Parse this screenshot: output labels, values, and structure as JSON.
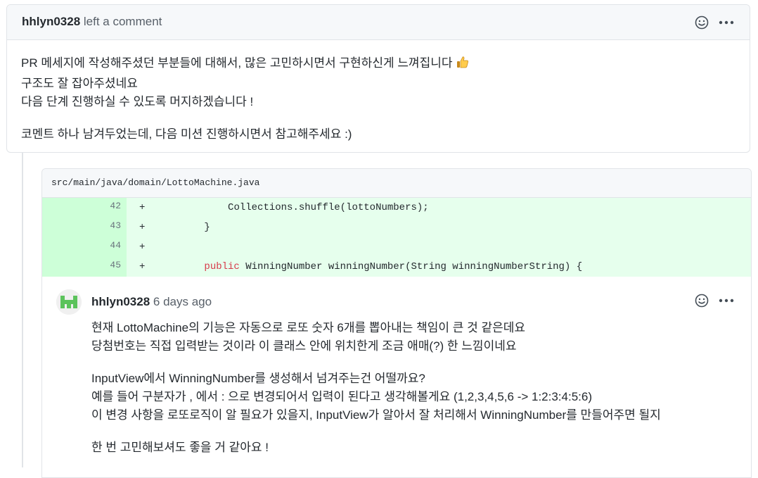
{
  "comment": {
    "author": "hhlyn0328",
    "action": "left a comment",
    "paragraphs": [
      [
        "PR 메세지에 작성해주셨던 부분들에 대해서, 많은 고민하시면서 구현하신게 느껴집니다",
        "구조도 잘 잡아주셨네요",
        "다음 단계 진행하실 수 있도록 머지하겠습니다 !"
      ],
      [
        "코멘트 하나 남겨두었는데, 다음 미션 진행하시면서 참고해주세요 :)"
      ]
    ],
    "emoji_icon": "thumbs-up-icon"
  },
  "review": {
    "file_path": "src/main/java/domain/LottoMachine.java",
    "diff_lines": [
      {
        "num": "42",
        "sign": "+",
        "code": "        Collections.shuffle(lottoNumbers);"
      },
      {
        "num": "43",
        "sign": "+",
        "code": "    }"
      },
      {
        "num": "44",
        "sign": "+",
        "code": ""
      },
      {
        "num": "45",
        "sign": "+",
        "keyword": "public",
        "code": " WinningNumber winningNumber(String winningNumberString) {"
      }
    ],
    "reply": {
      "author": "hhlyn0328",
      "time": "6 days ago",
      "lines": [
        "현재 LottoMachine의 기능은 자동으로 로또 숫자 6개를 뽑아내는 책임이 큰 것 같은데요",
        "당첨번호는 직접 입력받는 것이라 이 클래스 안에 위치한게 조금 애매(?) 한 느낌이네요",
        "",
        "InputView에서 WinningNumber를 생성해서 넘겨주는건 어떨까요?",
        "예를 들어 구분자가 , 에서 : 으로 변경되어서 입력이 된다고 생각해볼게요 (1,2,3,4,5,6 -> 1:2:3:4:5:6)",
        "이 변경 사항을 로또로직이 알 필요가 있을지, InputView가 알아서 잘 처리해서 WinningNumber를 만들어주면 될지",
        "",
        "한 번 고민해보셔도 좋을 거 같아요 !"
      ]
    }
  },
  "icons": {
    "reaction": "smiley-icon",
    "more": "kebab-horizontal-icon",
    "avatar": "identicon-avatar"
  },
  "colors": {
    "diff_add_bg": "#e6ffed",
    "diff_add_num_bg": "#cdffd8",
    "keyword": "#d73a49",
    "header_bg": "#f6f8fa",
    "avatar_green": "#5cc35c"
  }
}
